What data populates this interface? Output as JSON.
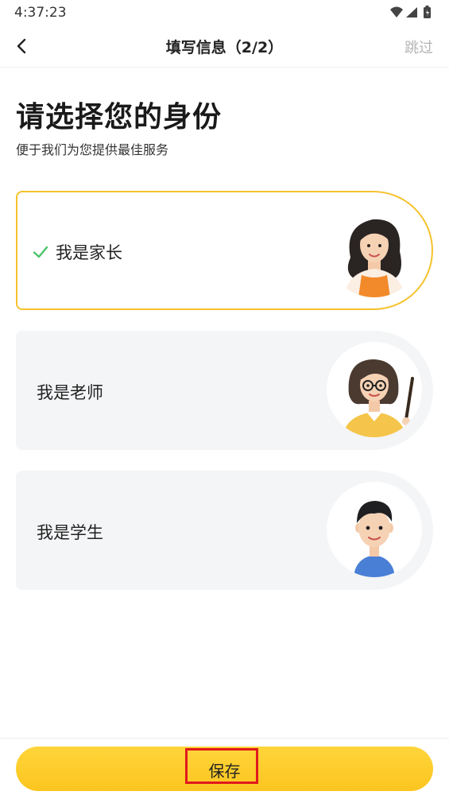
{
  "status_bar": {
    "time": "4:37:23",
    "icons": [
      "wifi-icon",
      "signal-icon",
      "battery-icon"
    ]
  },
  "nav": {
    "title": "填写信息（2/2）",
    "skip_label": "跳过",
    "back_icon": "chevron-left-icon"
  },
  "heading": "请选择您的身份",
  "subheading": "便于我们为您提供最佳服务",
  "roles": [
    {
      "label": "我是家长",
      "selected": true,
      "avatar": "parent-avatar"
    },
    {
      "label": "我是老师",
      "selected": false,
      "avatar": "teacher-avatar"
    },
    {
      "label": "我是学生",
      "selected": false,
      "avatar": "student-avatar"
    }
  ],
  "footer": {
    "save_label": "保存"
  },
  "colors": {
    "accent": "#f5c22e",
    "button": "#fbc51f",
    "card_bg": "#f4f5f7",
    "check": "#4cc46a",
    "highlight": "#e0191c"
  }
}
